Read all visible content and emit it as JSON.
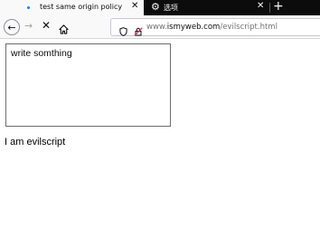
{
  "tabs": [
    {
      "title": "test same origin policy",
      "active": true,
      "icon": "loading-dot-icon"
    },
    {
      "title": "选项",
      "active": false,
      "icon": "gear-icon"
    }
  ],
  "toolbar": {
    "url_prefix": "www.",
    "url_host": "ismyweb.com",
    "url_path": "/evilscript.html"
  },
  "page": {
    "textarea_value": "write somthing",
    "message": "I am evilscript"
  },
  "colors": {
    "tabstrip_bg": "#0c0c0d",
    "active_tab_bg": "#f9f9fa",
    "loading_dot": "#0a84ff"
  }
}
